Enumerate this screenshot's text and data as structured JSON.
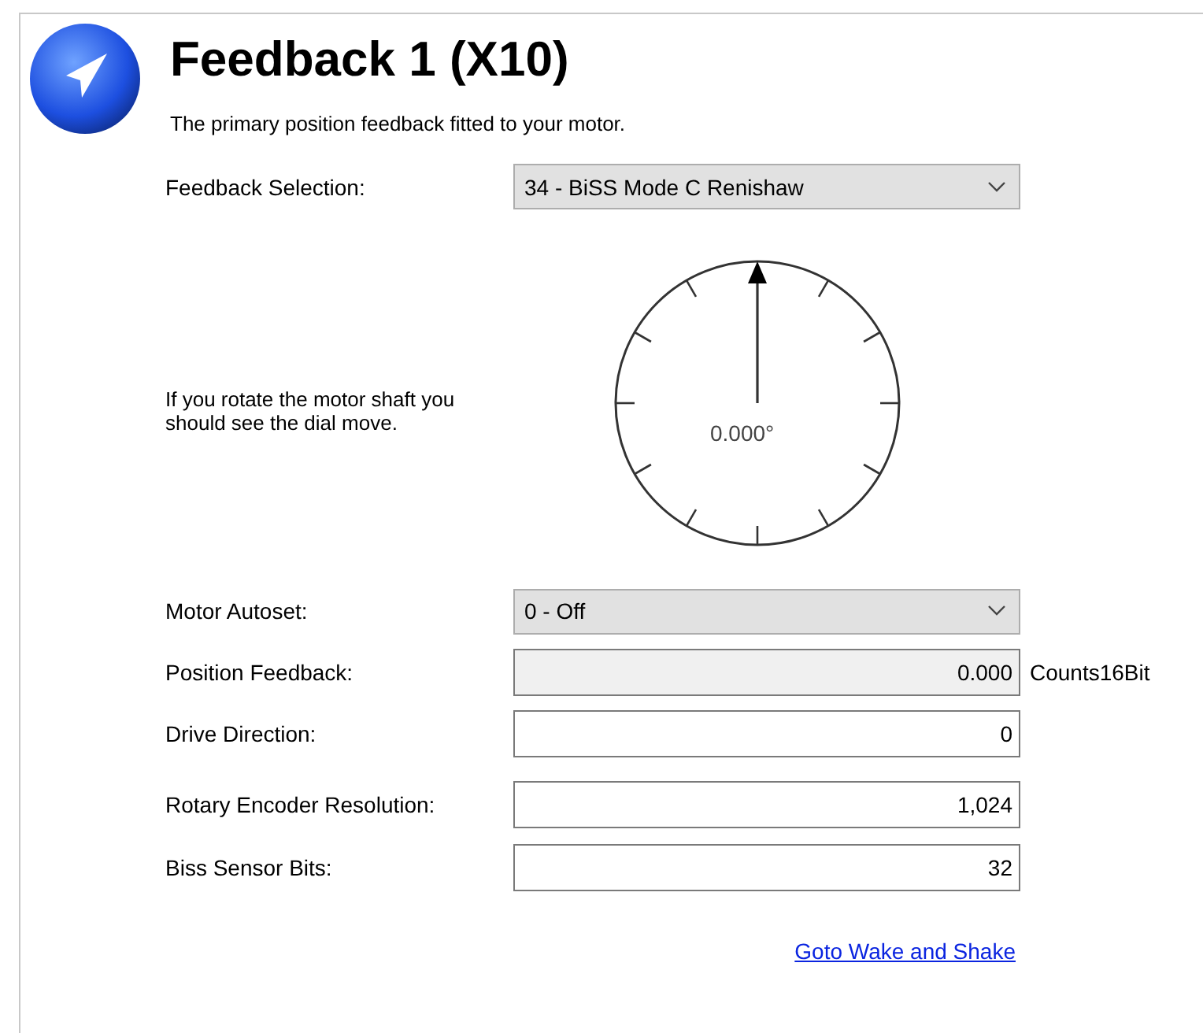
{
  "header": {
    "title": "Feedback 1 (X10)",
    "subtitle": "The primary position feedback fitted to your motor."
  },
  "feedback_selection": {
    "label": "Feedback Selection:",
    "value": "34 - BiSS Mode C Renishaw"
  },
  "dial": {
    "hint": "If you rotate the motor shaft you should see the dial move.",
    "reading": "0.000°"
  },
  "fields": [
    {
      "kind": "combo",
      "label": "Motor Autoset:",
      "value": "0 - Off"
    },
    {
      "kind": "readonly",
      "label": "Position Feedback:",
      "value": "0.000",
      "unit": "Counts16Bit"
    },
    {
      "kind": "input",
      "label": "Drive Direction:",
      "value": "0"
    },
    {
      "kind": "input",
      "label": "Rotary Encoder Resolution:",
      "value": "1,024"
    },
    {
      "kind": "input",
      "label": "Biss Sensor Bits:",
      "value": "32"
    }
  ],
  "link": "Goto Wake and Shake"
}
